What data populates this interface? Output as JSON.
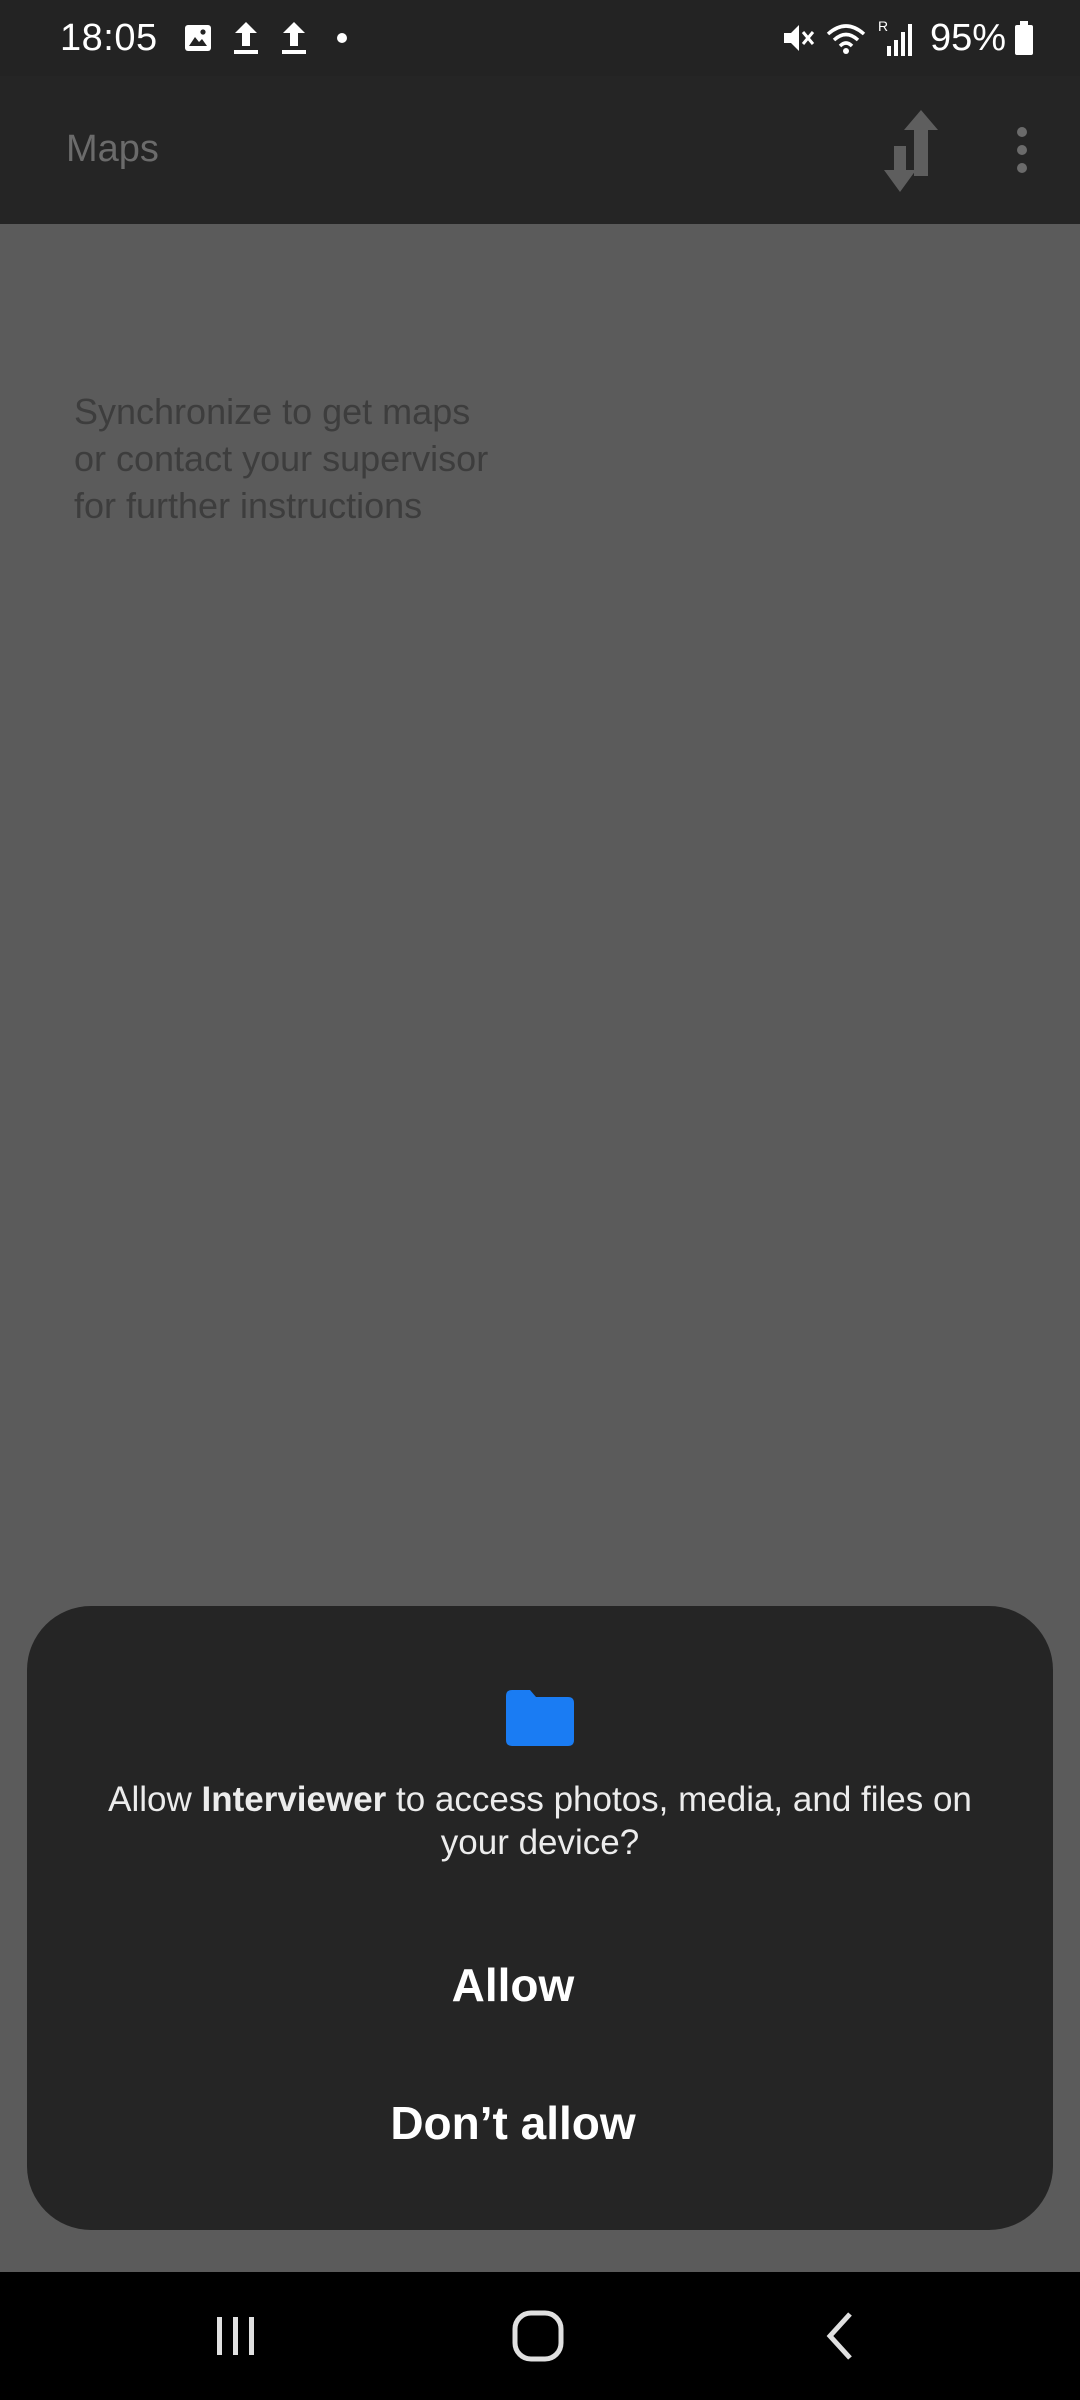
{
  "status_bar": {
    "time": "18:05",
    "left_icons": [
      "gallery-icon",
      "upload-icon",
      "upload-icon",
      "notification-dot-icon"
    ],
    "right_icons": [
      "mute-icon",
      "wifi-icon",
      "signal-icon",
      "battery-icon"
    ],
    "battery": "95%",
    "signal_label": "R"
  },
  "app_bar": {
    "title": "Maps",
    "actions": [
      "sync-icon",
      "more-vert-icon"
    ]
  },
  "content": {
    "empty_message": "Synchronize to get maps\nor contact your supervisor\nfor further instructions"
  },
  "dialog": {
    "icon": "folder-icon",
    "icon_color": "#1a7cf3",
    "message_prefix": "Allow ",
    "app_name": "Interviewer",
    "message_suffix": " to access photos, media, and files on your device?",
    "allow_label": "Allow",
    "deny_label": "Don’t allow"
  },
  "nav_bar": {
    "buttons": [
      "recents-icon",
      "home-icon",
      "back-icon"
    ]
  }
}
